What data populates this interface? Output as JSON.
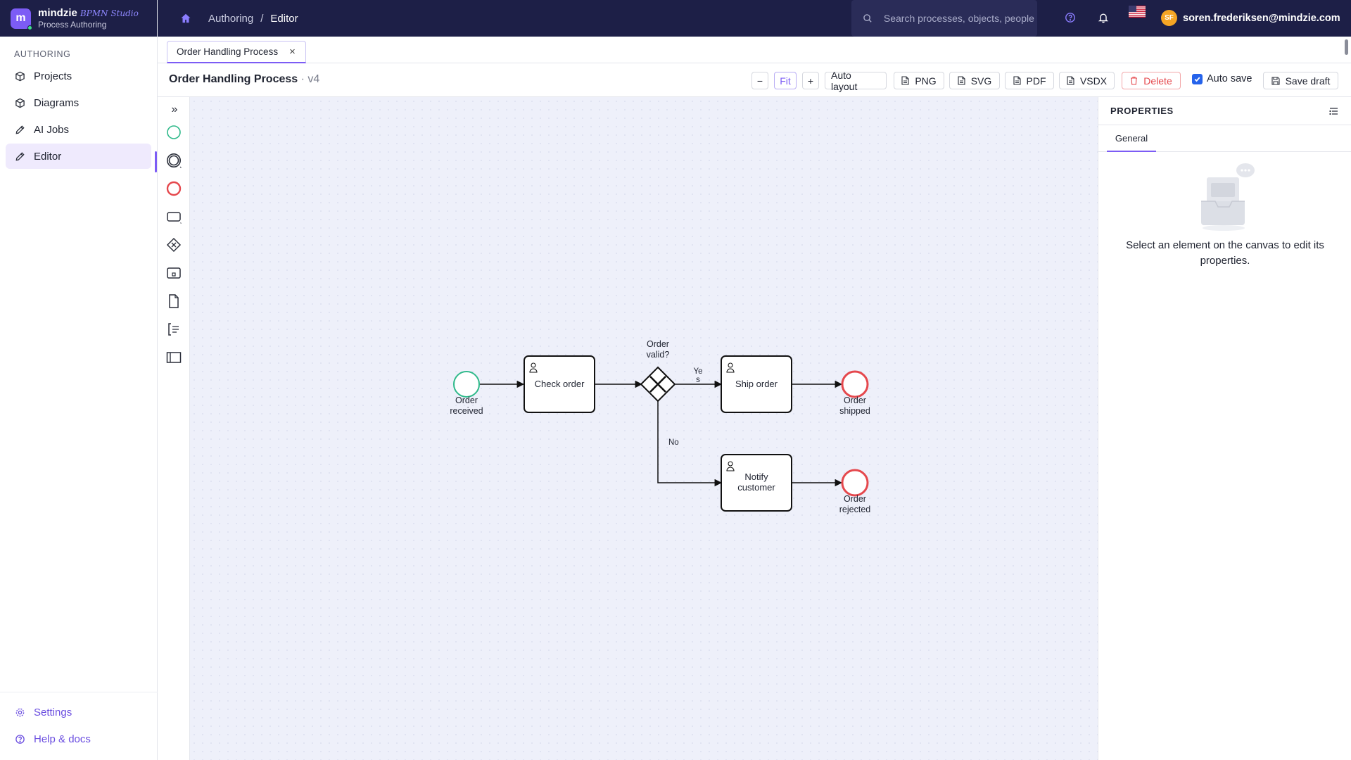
{
  "brand": {
    "name": "mindzie",
    "studio": "BPMN Studio",
    "subtitle": "Process Authoring",
    "logo_letter": "m"
  },
  "sidebar": {
    "section": "AUTHORING",
    "items": [
      {
        "label": "Projects",
        "icon": "cube-icon"
      },
      {
        "label": "Diagrams",
        "icon": "cube-icon"
      },
      {
        "label": "AI Jobs",
        "icon": "pencil-icon"
      },
      {
        "label": "Editor",
        "icon": "pencil-icon",
        "active": true
      }
    ],
    "bottom": [
      {
        "label": "Settings",
        "icon": "gear-icon"
      },
      {
        "label": "Help & docs",
        "icon": "help-icon"
      }
    ]
  },
  "topbar": {
    "breadcrumb": [
      "Authoring",
      "Editor"
    ],
    "separator": "/",
    "search_placeholder": "Search processes, objects, people",
    "user_initials": "SF",
    "user_email": "soren.frederiksen@mindzie.com"
  },
  "tabs": [
    {
      "label": "Order Handling Process",
      "close": "×"
    }
  ],
  "toolbar": {
    "title": "Order Handling Process",
    "version": " · v4",
    "zoom_out": "−",
    "fit": "Fit",
    "zoom_in": "+",
    "auto_layout": "Auto layout",
    "export_png": "PNG",
    "export_svg": "SVG",
    "export_pdf": "PDF",
    "export_vsdx": "VSDX",
    "delete": "Delete",
    "auto_save": "Auto save",
    "auto_save_checked": true,
    "save_draft": "Save draft"
  },
  "palette": {
    "expand": "»",
    "tools": [
      "start-event-icon",
      "intermediate-event-icon",
      "end-event-icon",
      "task-icon",
      "gateway-icon",
      "subprocess-icon",
      "data-object-icon",
      "annotation-icon",
      "pool-icon"
    ]
  },
  "diagram": {
    "start_event": {
      "label_line1": "Order",
      "label_line2": "received"
    },
    "task_check": {
      "label": "Check order"
    },
    "gateway": {
      "label_line1": "Order",
      "label_line2": "valid?"
    },
    "flow_yes": {
      "label_line1": "Ye",
      "label_line2": "s"
    },
    "flow_no": {
      "label": "No"
    },
    "task_ship": {
      "label": "Ship order"
    },
    "task_notify": {
      "label_line1": "Notify",
      "label_line2": "customer"
    },
    "end_shipped": {
      "label_line1": "Order",
      "label_line2": "shipped"
    },
    "end_rejected": {
      "label_line1": "Order",
      "label_line2": "rejected"
    }
  },
  "properties": {
    "title": "PROPERTIES",
    "tab": "General",
    "empty_message": "Select an element on the canvas to edit its properties."
  },
  "colors": {
    "nav_bg": "#1d1f47",
    "accent": "#7c5cf5",
    "start_event": "#2fb98a",
    "end_event": "#e5484d",
    "canvas_bg": "#eef0fa"
  }
}
